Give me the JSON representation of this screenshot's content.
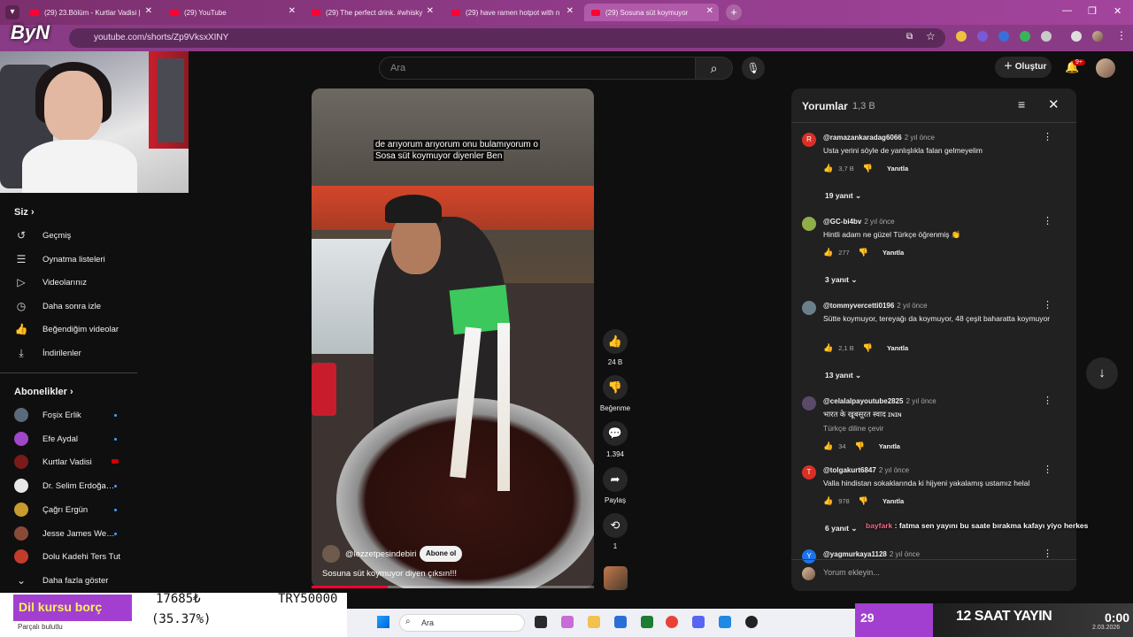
{
  "browser": {
    "tabs": [
      {
        "label": "(29) 23.Bölüm - Kurtlar Vadisi |",
        "active": false
      },
      {
        "label": "(29) YouTube",
        "active": false
      },
      {
        "label": "(29) The perfect drink. #whisky",
        "active": false
      },
      {
        "label": "(29) have ramen hotpot with n",
        "active": false
      },
      {
        "label": "(29) Sosuna süt koymuyor",
        "active": true
      }
    ],
    "url": "youtube.com/shorts/Zp9VksxXINY"
  },
  "header": {
    "search_placeholder": "Ara",
    "create_label": "Oluştur",
    "notif_badge": "9+"
  },
  "webcam": {
    "logo_text": "ByN"
  },
  "sidebar": {
    "you_heading": "Siz",
    "you_items": [
      {
        "label": "Geçmiş",
        "icon": "history-icon"
      },
      {
        "label": "Oynatma listeleri",
        "icon": "playlist-icon"
      },
      {
        "label": "Videolarınız",
        "icon": "your-videos-icon"
      },
      {
        "label": "Daha sonra izle",
        "icon": "watch-later-icon"
      },
      {
        "label": "Beğendiğim videolar",
        "icon": "liked-icon"
      },
      {
        "label": "İndirilenler",
        "icon": "download-icon"
      }
    ],
    "subs_heading": "Abonelikler",
    "subs": [
      {
        "label": "Foşix Erlik",
        "color": "#5a6a7a"
      },
      {
        "label": "Efe Aydal",
        "color": "#a046c8"
      },
      {
        "label": "Kurtlar Vadisi",
        "color": "#7a1a1a"
      },
      {
        "label": "Dr. Selim Erdoğa…",
        "color": "#e8e8e8"
      },
      {
        "label": "Çağrı Ergün",
        "color": "#c79b2d"
      },
      {
        "label": "Jesse James We…",
        "color": "#8a4a3a"
      },
      {
        "label": "Dolu Kadehi Ters Tut",
        "color": "#c33b2b"
      }
    ],
    "show_more": "Daha fazla göster"
  },
  "stream_overlay": {
    "goal_label": "Dil kursu borç",
    "amount": "17685₺",
    "percent": "(35.37%)",
    "goal": "TRY50000",
    "download_status": "Parçalı bulutlu"
  },
  "video": {
    "caption_line1": "de arıyorum arıyorum onu bulamıyorum o",
    "caption_line2": "Sosa süt koymuyor diyenler Ben",
    "channel": "@lezzetpesindebiri",
    "subscribe_label": "Abone ol",
    "title": "Sosuna süt koymuyor diyen çıksın!!!",
    "progress": 0.27
  },
  "actions": {
    "likes": "24 B",
    "dislike_label": "Beğenme",
    "comments": "1.394",
    "share_label": "Paylaş",
    "remix": "1"
  },
  "comments_panel": {
    "title": "Yorumlar",
    "count": "1,3 B",
    "comments": [
      {
        "user": "@ramazankaradag6066",
        "time": "2 yıl önce",
        "text": "Usta yerini söyle de yanlışlıkla falan gelmeyelim",
        "likes": "3,7 B",
        "replies": "19 yanıt",
        "avatar_letter": "R",
        "avatar_color": "#d93025"
      },
      {
        "user": "@GC-bi4bv",
        "time": "2 yıl önce",
        "text": "Hintli adam ne güzel Türkçe öğrenmiş 👏",
        "likes": "277",
        "replies": "3 yanıt",
        "avatar_letter": "",
        "avatar_color": "#8fae4a"
      },
      {
        "user": "@tommyvercetti0196",
        "time": "2 yıl önce",
        "text": "Sütte koymuyor, tereyağı da koymuyor, 48 çeşit baharatta koymuyor",
        "likes": "2,1 B",
        "replies": "13 yanıt",
        "avatar_letter": "",
        "avatar_color": "#6b7f8a"
      },
      {
        "user": "@celalalpayoutube2825",
        "time": "2 yıl önce",
        "text": "भारत के खूबसूरत स्वाद ɪɴɪɴ",
        "translate": "Türkçe diline çevir",
        "likes": "34",
        "replies": "",
        "avatar_letter": "",
        "avatar_color": "#5a4a6a"
      },
      {
        "user": "@tolgakurt6847",
        "time": "2 yıl önce",
        "text": "Valla hindistan sokaklarında ki hijyeni yakalamış ustamız helal",
        "likes": "978",
        "replies": "6 yanıt",
        "avatar_letter": "T",
        "avatar_color": "#d93025"
      },
      {
        "user": "@yagmurkaya1128",
        "time": "2 yıl önce",
        "text": "",
        "likes": "",
        "replies": "",
        "avatar_letter": "Y",
        "avatar_color": "#1a73e8"
      }
    ],
    "reply_label": "Yanıtla",
    "input_placeholder": "Yorum ekleyin..."
  },
  "chat_overlay": {
    "name": "bayfark",
    "message": ": fatma sen yayını bu saate bırakma kafayı yiyo herkes"
  },
  "taskbar": {
    "search": "Ara",
    "tray_number": "29",
    "tray_title": "12 SAAT YAYIN",
    "time": "0:00",
    "date": "2.03.2026"
  }
}
